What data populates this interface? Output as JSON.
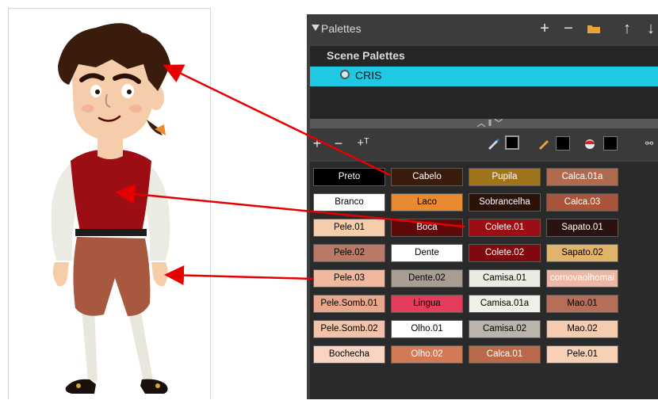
{
  "palettes_window": {
    "title": "Palettes",
    "toolbar_icons": [
      "add-icon",
      "remove-icon",
      "folder-icon",
      "arrow-up-icon",
      "arrow-down-icon"
    ],
    "scene_palettes_header": "Scene Palettes",
    "scene_palettes": [
      {
        "label": "CRIS",
        "selected": true
      }
    ]
  },
  "colors": {
    "title_bar": "#3c3c3c",
    "scene_list_bg": "#262626",
    "selection": "#1fc8e3",
    "swatch_list_bg": "#2a2a2a",
    "arrow": "#e60000"
  },
  "swatches": [
    [
      "Preto",
      "Cabelo",
      "Pupila",
      "Calca.01a"
    ],
    [
      "Branco",
      "Laco",
      "Sobrancelha",
      "Calca.03"
    ],
    [
      "Pele.01",
      "Boca",
      "Colete.01",
      "Sapato.01"
    ],
    [
      "Pele.02",
      "Dente",
      "Colete.02",
      "Sapato.02"
    ],
    [
      "Pele.03",
      "Dente.02",
      "Camisa.01",
      "cornovaolhomai"
    ],
    [
      "Pele.Somb.01",
      "Lingua",
      "Camisa.01a",
      "Mao.01"
    ],
    [
      "Pele.Somb.02",
      "Olho.01",
      "Camisa.02",
      "Mao.02"
    ],
    [
      "Bochecha",
      "Olho.02",
      "Calca.01",
      "Pele.01"
    ]
  ],
  "swatch_colors": [
    [
      "#000000",
      "#3a1c0c",
      "#a0741c",
      "#b06a4e"
    ],
    [
      "#ffffff",
      "#e88a32",
      "#2a1208",
      "#a8553b"
    ],
    [
      "#f6cdaa",
      "#5e0a0a",
      "#9c0d14",
      "#2a1210"
    ],
    [
      "#b87a66",
      "#ffffff",
      "#7e0a0e",
      "#e1b46c"
    ],
    [
      "#f0b89c",
      "#a89d91",
      "#ecebe3",
      "#ecb7a4"
    ],
    [
      "#e8a88c",
      "#e63c5c",
      "#f0efe8",
      "#b66e58"
    ],
    [
      "#f2c3a8",
      "#ffffff",
      "#b9b5ad",
      "#f6ccb0"
    ],
    [
      "#f9d4c2",
      "#d27a56",
      "#b86a4a",
      "#f7d0b6"
    ]
  ],
  "swatch_text_colors": [
    [
      "#ffffff",
      "#ffffff",
      "#ffffff",
      "#ffffff"
    ],
    [
      "#000000",
      "#000000",
      "#ffffff",
      "#ffffff"
    ],
    [
      "#000000",
      "#ffffff",
      "#ffffff",
      "#ffffff"
    ],
    [
      "#000000",
      "#000000",
      "#ffffff",
      "#000000"
    ],
    [
      "#000000",
      "#000000",
      "#000000",
      "#ffffff"
    ],
    [
      "#000000",
      "#000000",
      "#000000",
      "#000000"
    ],
    [
      "#000000",
      "#000000",
      "#000000",
      "#000000"
    ],
    [
      "#000000",
      "#ffffff",
      "#ffffff",
      "#000000"
    ]
  ]
}
